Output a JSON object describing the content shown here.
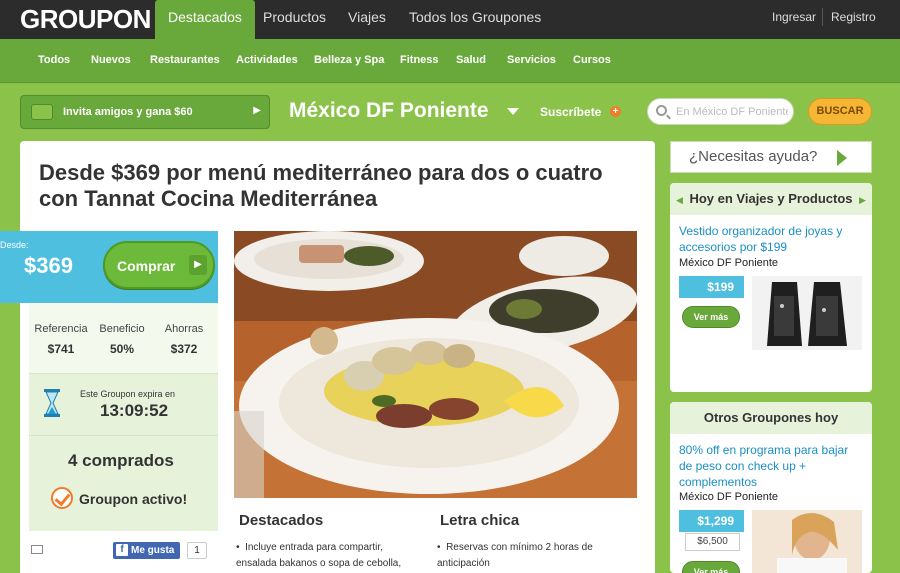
{
  "header": {
    "logo": "GROUPON",
    "tabs": [
      "Destacados",
      "Productos",
      "Viajes",
      "Todos los Groupones"
    ],
    "login": "Ingresar",
    "register": "Registro"
  },
  "subnav": [
    "Todos",
    "Nuevos",
    "Restaurantes",
    "Actividades",
    "Belleza y Spa",
    "Fitness",
    "Salud",
    "Servicios",
    "Cursos"
  ],
  "toolbar": {
    "invite_label": "Invita amigos y gana $60",
    "city": "México DF Poniente",
    "subscribe": "Suscríbete",
    "search_placeholder": "En México DF Poniente",
    "search_button": "BUSCAR"
  },
  "deal": {
    "title": "Desde $369 por menú mediterráneo para dos o cuatro con Tannat Cocina Mediterránea",
    "desde_label": "Desde:",
    "price": "$369",
    "buy_label": "Comprar",
    "stats": [
      {
        "label": "Referencia",
        "value": "$741"
      },
      {
        "label": "Beneficio",
        "value": "50%"
      },
      {
        "label": "Ahorras",
        "value": "$372"
      }
    ],
    "expires_label": "Este Groupon expira en",
    "timer": "13:09:52",
    "bought": "4 comprados",
    "active_label": "Groupon activo!",
    "fb_label": "Me gusta",
    "fb_count": "1",
    "highlights_title": "Destacados",
    "highlights": [
      "Incluye entrada para compartir, ensalada bakanos o sopa de cebolla,"
    ],
    "fine_print_title": "Letra chica",
    "fine_print": [
      "Reservas con mínimo 2 horas de anticipación"
    ]
  },
  "sidebar": {
    "help": "¿Necesitas ayuda?",
    "today_title": "Hoy en Viajes y Productos",
    "item1": {
      "title": "Vestido organizador de joyas y accesorios por $199",
      "location": "México DF Poniente",
      "price": "$199",
      "more": "Ver más"
    },
    "others_title": "Otros Groupones hoy",
    "item2": {
      "title": "80% off en programa para bajar de peso con check up + complementos",
      "location": "México DF Poniente",
      "price": "$1,299",
      "original": "$6,500",
      "more": "Ver más"
    }
  },
  "colors": {
    "brand_green": "#69a83b",
    "background": "#8bc34a",
    "price_blue": "#4fbfdf",
    "link_blue": "#1a8fc4",
    "accent_orange": "#f07c2a"
  }
}
